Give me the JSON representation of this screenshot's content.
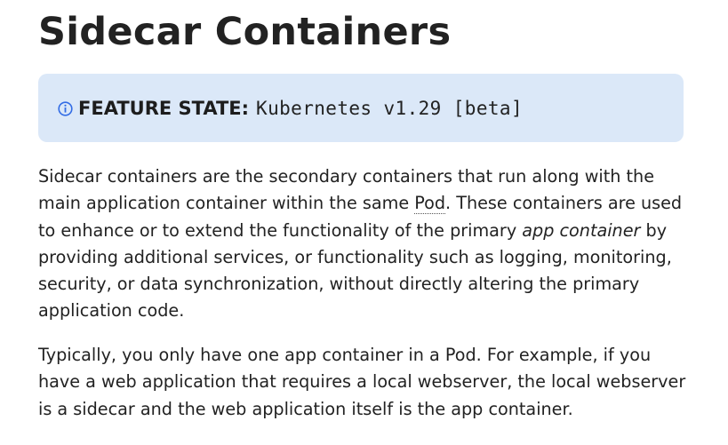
{
  "page": {
    "title": "Sidecar Containers"
  },
  "feature_state": {
    "icon": "info-icon",
    "label": "FEATURE STATE:",
    "value": "Kubernetes v1.29 [beta]",
    "background_color": "#dbe8f8",
    "icon_color": "#326ce5"
  },
  "paragraph1": {
    "part1": "Sidecar containers are the secondary containers that run along with the main application container within the same ",
    "link_pod": "Pod",
    "part2": ". These containers are used to enhance or to extend the functionality of the primary ",
    "emphasis": "app container",
    "part3": " by providing additional services, or functionality such as logging, monitoring, security, or data synchronization, without directly altering the primary application code."
  },
  "paragraph2": {
    "text": "Typically, you only have one app container in a Pod. For example, if you have a web application that requires a local webserver, the local webserver is a sidecar and the web application itself is the app container."
  }
}
